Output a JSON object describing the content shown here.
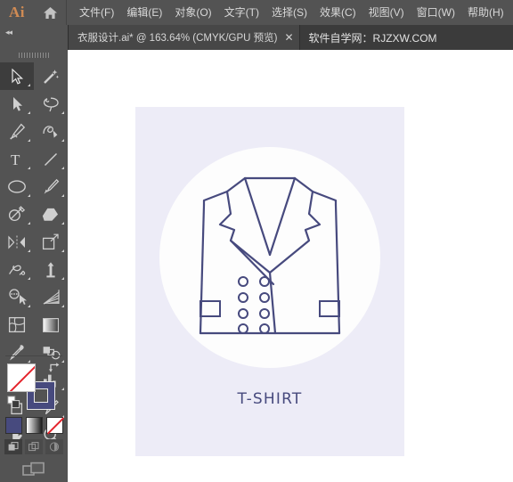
{
  "app": {
    "logo_text": "Ai",
    "logo_color": "#d08b54",
    "home_icon": "home-icon"
  },
  "menubar": {
    "items": [
      {
        "label": "文件(F)",
        "name": "menu-file"
      },
      {
        "label": "编辑(E)",
        "name": "menu-edit"
      },
      {
        "label": "对象(O)",
        "name": "menu-object"
      },
      {
        "label": "文字(T)",
        "name": "menu-type"
      },
      {
        "label": "选择(S)",
        "name": "menu-select"
      },
      {
        "label": "效果(C)",
        "name": "menu-effect"
      },
      {
        "label": "视图(V)",
        "name": "menu-view"
      },
      {
        "label": "窗口(W)",
        "name": "menu-window"
      },
      {
        "label": "帮助(H)",
        "name": "menu-help"
      }
    ]
  },
  "tabbar": {
    "collapse_icon": "◂◂",
    "tab": {
      "title": "衣服设计.ai* @ 163.64% (CMYK/GPU 预览)",
      "close_glyph": "✕",
      "document_name": "衣服设计.ai",
      "modified": "*",
      "zoom": "163.64%",
      "color_mode": "CMYK/GPU 预览"
    },
    "watermark": "软件自学网：RJZXW.COM"
  },
  "toolbar": {
    "tools": [
      {
        "name": "selection-tool",
        "label": "选择工具",
        "active": true
      },
      {
        "name": "magic-wand-tool",
        "label": "魔棒工具",
        "active": false
      },
      {
        "name": "direct-selection-tool",
        "label": "直接选择工具",
        "active": false
      },
      {
        "name": "lasso-tool",
        "label": "套索工具",
        "active": false
      },
      {
        "name": "pen-tool",
        "label": "钢笔工具",
        "active": false
      },
      {
        "name": "curvature-tool",
        "label": "曲率工具",
        "active": false
      },
      {
        "name": "type-tool",
        "label": "文字工具",
        "active": false
      },
      {
        "name": "line-segment-tool",
        "label": "直线段工具",
        "active": false
      },
      {
        "name": "ellipse-tool",
        "label": "椭圆工具",
        "active": false
      },
      {
        "name": "paintbrush-tool",
        "label": "画笔工具",
        "active": false
      },
      {
        "name": "shaper-tool",
        "label": "Shaper 工具",
        "active": false
      },
      {
        "name": "eraser-tool",
        "label": "橡皮擦工具",
        "active": false
      },
      {
        "name": "rotate-tool",
        "label": "旋转工具",
        "active": false
      },
      {
        "name": "scale-tool",
        "label": "比例缩放工具",
        "active": false
      },
      {
        "name": "width-tool",
        "label": "宽度工具",
        "active": false
      },
      {
        "name": "free-transform-tool",
        "label": "自由变换工具",
        "active": false
      },
      {
        "name": "shape-builder-tool",
        "label": "形状生成器工具",
        "active": false
      },
      {
        "name": "perspective-grid-tool",
        "label": "透视网格工具",
        "active": false
      },
      {
        "name": "mesh-tool",
        "label": "网格工具",
        "active": false
      },
      {
        "name": "gradient-tool",
        "label": "渐变工具",
        "active": false
      },
      {
        "name": "eyedropper-tool",
        "label": "吸管工具",
        "active": false
      },
      {
        "name": "blend-tool",
        "label": "混合工具",
        "active": false
      },
      {
        "name": "symbol-sprayer-tool",
        "label": "符号喷枪工具",
        "active": false
      },
      {
        "name": "column-graph-tool",
        "label": "柱形图工具",
        "active": false
      },
      {
        "name": "artboard-tool",
        "label": "画板工具",
        "active": false
      },
      {
        "name": "slice-tool",
        "label": "切片工具",
        "active": false
      },
      {
        "name": "hand-tool",
        "label": "抓手工具",
        "active": false
      },
      {
        "name": "zoom-tool",
        "label": "缩放工具",
        "active": false
      }
    ],
    "colors": {
      "fill_label": "填色",
      "fill_value": "无",
      "fill_color": "#ffffff",
      "none_slash_color": "#e4232b",
      "stroke_label": "描边",
      "stroke_color": "#474a7e",
      "swap_icon": "swap-fill-stroke-icon",
      "default_icon": "default-fill-stroke-icon"
    },
    "paint_modes": [
      {
        "name": "color-mode-button",
        "label": "颜色"
      },
      {
        "name": "gradient-mode-button",
        "label": "渐变"
      },
      {
        "name": "none-mode-button",
        "label": "无"
      }
    ],
    "draw_modes": [
      {
        "name": "draw-normal-button",
        "label": "正常绘图",
        "active": true
      },
      {
        "name": "draw-behind-button",
        "label": "背面绘图",
        "active": false
      },
      {
        "name": "draw-inside-button",
        "label": "内部绘图",
        "active": false
      }
    ],
    "screen_mode": {
      "name": "change-screen-mode-button",
      "label": "更改屏幕模式"
    }
  },
  "artwork": {
    "background_color": "#edecf7",
    "disc_color": "#fdfdfd",
    "stroke_color": "#474a7e",
    "label": "T-SHIRT",
    "subject": "vest-line-art",
    "button_rows": 4,
    "button_columns": 2,
    "pocket_count": 2
  }
}
